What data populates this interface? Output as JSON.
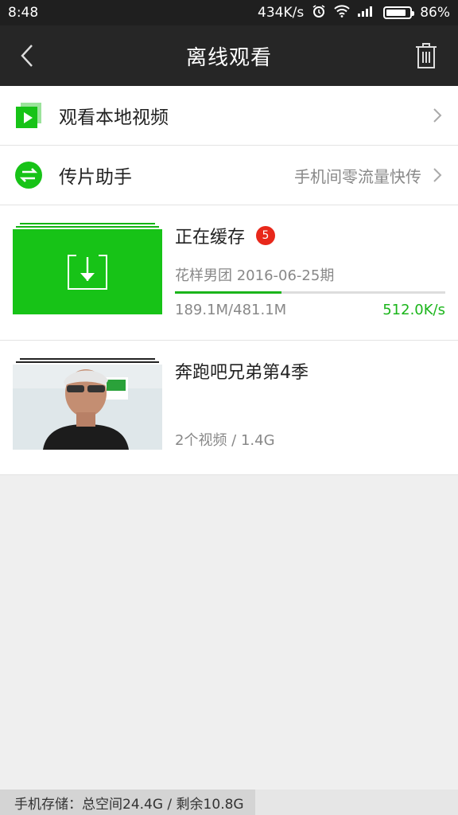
{
  "status_bar": {
    "time": "8:48",
    "net_speed": "434K/s",
    "battery": "86%",
    "battery_level": 0.86
  },
  "app_bar": {
    "title": "离线观看",
    "icons": [
      "back-icon",
      "trash-icon"
    ]
  },
  "menu": {
    "local_video": {
      "label": "观看本地视频",
      "icon": "play-square-icon"
    },
    "transfer": {
      "label": "传片助手",
      "hint": "手机间零流量快传",
      "icon": "transfer-icon"
    }
  },
  "downloading": {
    "title": "正在缓存",
    "badge": "5",
    "current_item": "花样男团 2016-06-25期",
    "size_progress": "189.1M/481.1M",
    "speed": "512.0K/s",
    "progress": 0.393,
    "icon": "download-icon"
  },
  "show": {
    "title": "奔跑吧兄弟第4季",
    "meta": "2个视频 / 1.4G"
  },
  "storage": {
    "text": "手机存储：总空间24.4G / 剩余10.8G",
    "used_fraction": 0.557
  },
  "colors": {
    "accent_green": "#17c317",
    "badge_red": "#e8281b",
    "appbar_bg": "#262626"
  }
}
